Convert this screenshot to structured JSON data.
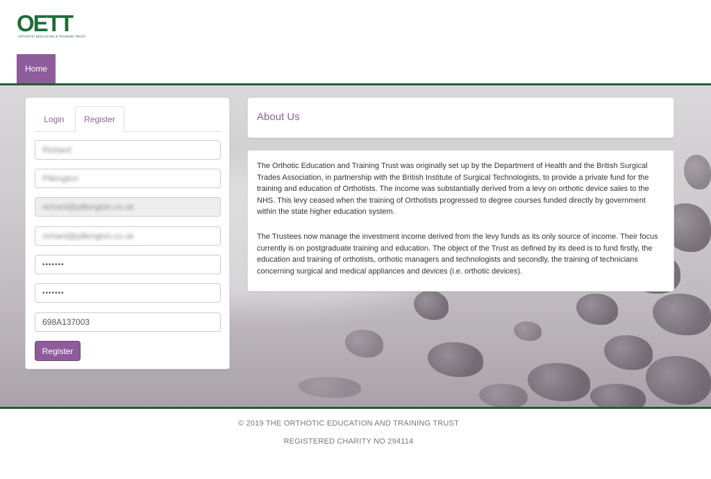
{
  "brand": {
    "logo_text": "OETT",
    "logo_subtitle": "ORTHOTIC EDUCATION & TRAINING TRUST",
    "accent_color": "#8e5c9b",
    "rule_color": "#1e5f33"
  },
  "nav": {
    "home_label": "Home"
  },
  "register_form": {
    "tabs": {
      "login": "Login",
      "register": "Register"
    },
    "fields": {
      "first_name": "Richard",
      "last_name": "Pilkington",
      "email_readonly": "richard@pilkington.co.uk",
      "email": "richard@pilkington.co.uk",
      "password": "•••••••",
      "confirm_password": "•••••••",
      "code": "698A137003"
    },
    "submit_label": "Register"
  },
  "about": {
    "title": "About Us",
    "paragraph_1": "The Orthotic Education and Training Trust was originally set up by the Department of Health and the British Surgical Trades Association, in partnership with the British Institute of Surgical Technologists, to provide a private fund for the training and education of Orthotists. The income was substantially derived from a levy on orthotic device sales to the NHS. This levy ceased when the training of Orthotists progressed to degree courses funded directly by government within the state higher education system.",
    "paragraph_2": "The Trustees now manage the investment income derived from the levy funds as its only source of income. Their focus currently is on postgraduate training and education. The object of the Trust as defined by its deed is to fund firstly, the education and training of orthotists, orthotic managers and technologists and secondly, the training of technicians concerning surgical and medical appliances and devices (i.e. orthotic devices)."
  },
  "footer": {
    "copyright": "© 2019 THE ORTHOTIC EDUCATION AND TRAINING TRUST",
    "charity": "REGISTERED CHARITY NO 294114"
  }
}
